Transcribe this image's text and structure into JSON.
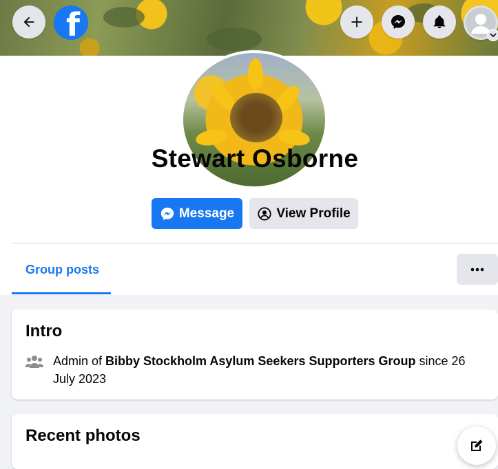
{
  "nav": {
    "back_icon": "arrow-left-icon",
    "logo_letter": "f",
    "create_icon": "plus-icon",
    "messenger_icon": "messenger-icon",
    "notifications_icon": "bell-icon",
    "account_icon": "avatar-icon"
  },
  "profile": {
    "name": "Stewart Osborne",
    "message_label": "Message",
    "view_profile_label": "View Profile"
  },
  "tabs": {
    "group_posts": "Group posts",
    "more_label": "•••"
  },
  "intro": {
    "title": "Intro",
    "prefix": "Admin of ",
    "group_name": "Bibby Stockholm Asylum Seekers Supporters Group",
    "suffix": " since 26 July 2023"
  },
  "photos": {
    "title": "Recent photos"
  },
  "colors": {
    "brand_blue": "#1877f2",
    "button_grey": "#e4e6eb",
    "page_bg": "#f0f2f5"
  }
}
